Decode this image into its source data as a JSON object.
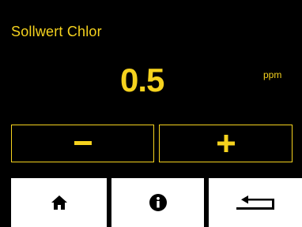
{
  "screen": {
    "title": "Sollwert Chlor",
    "value": "0.5",
    "unit": "ppm"
  },
  "controls": {
    "decrease_icon": "minus-icon",
    "increase_icon": "plus-icon"
  },
  "nav": {
    "home_icon": "home-icon",
    "info_icon": "info-icon",
    "back_icon": "return-icon"
  },
  "colors": {
    "background": "#000000",
    "accent": "#f5d21e",
    "nav_button": "#ffffff"
  }
}
